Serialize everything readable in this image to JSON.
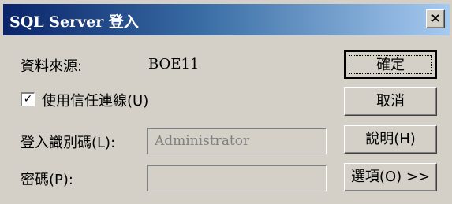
{
  "window": {
    "title": "SQL Server 登入",
    "close_label": "×"
  },
  "form": {
    "datasource_label": "資料來源:",
    "datasource_value": "BOE11",
    "trusted_label": "使用信任連線(U)",
    "trusted_checked": true,
    "login_label": "登入識別碼(L):",
    "login_value": "Administrator",
    "password_label": "密碼(P):",
    "password_value": ""
  },
  "buttons": {
    "ok": "確定",
    "cancel": "取消",
    "help": "說明(H)",
    "options": "選項(O) >>"
  }
}
